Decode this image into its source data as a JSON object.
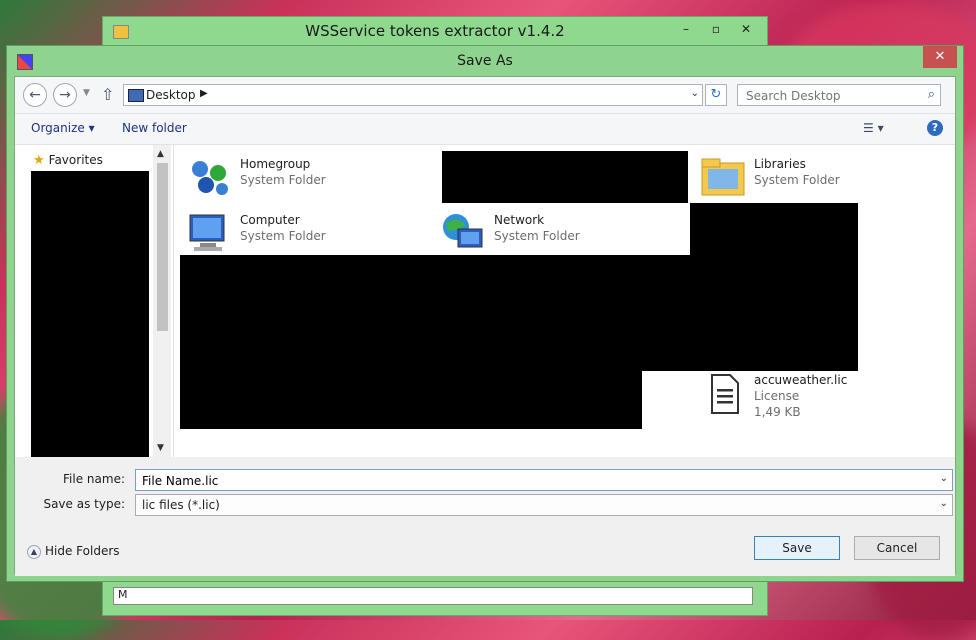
{
  "app_window": {
    "title": "WSService tokens extractor v1.4.2",
    "bottom_field_text": "M",
    "controls": [
      "–",
      "▫",
      "✕"
    ]
  },
  "dialog": {
    "title": "Save As",
    "close_symbol": "✕"
  },
  "address_bar": {
    "location": "Desktop",
    "search_placeholder": "Search Desktop"
  },
  "toolbar": {
    "organize_label": "Organize ▾",
    "new_folder_label": "New folder",
    "help_symbol": "?"
  },
  "nav_pane": {
    "favorites_label": "Favorites"
  },
  "items": [
    {
      "name": "Homegroup",
      "type": "System Folder",
      "icon": "homegroup-icon"
    },
    {
      "name": "Libraries",
      "type": "System Folder",
      "icon": "libraries-icon"
    },
    {
      "name": "Computer",
      "type": "System Folder",
      "icon": "computer-icon"
    },
    {
      "name": "Network",
      "type": "System Folder",
      "icon": "network-icon"
    },
    {
      "name": "accuweather.lic",
      "type": "License",
      "size": "1,49 KB",
      "icon": "document-icon"
    }
  ],
  "form": {
    "file_name_label": "File name:",
    "file_name_value": "File Name.lic",
    "save_type_label": "Save as type:",
    "save_type_value": "lic files (*.lic)",
    "hide_folders_label": "Hide Folders",
    "save_label": "Save",
    "cancel_label": "Cancel"
  },
  "colors": {
    "dialog_frame": "#8ed48e",
    "close_button": "#c75050",
    "link_text": "#1e3287"
  }
}
